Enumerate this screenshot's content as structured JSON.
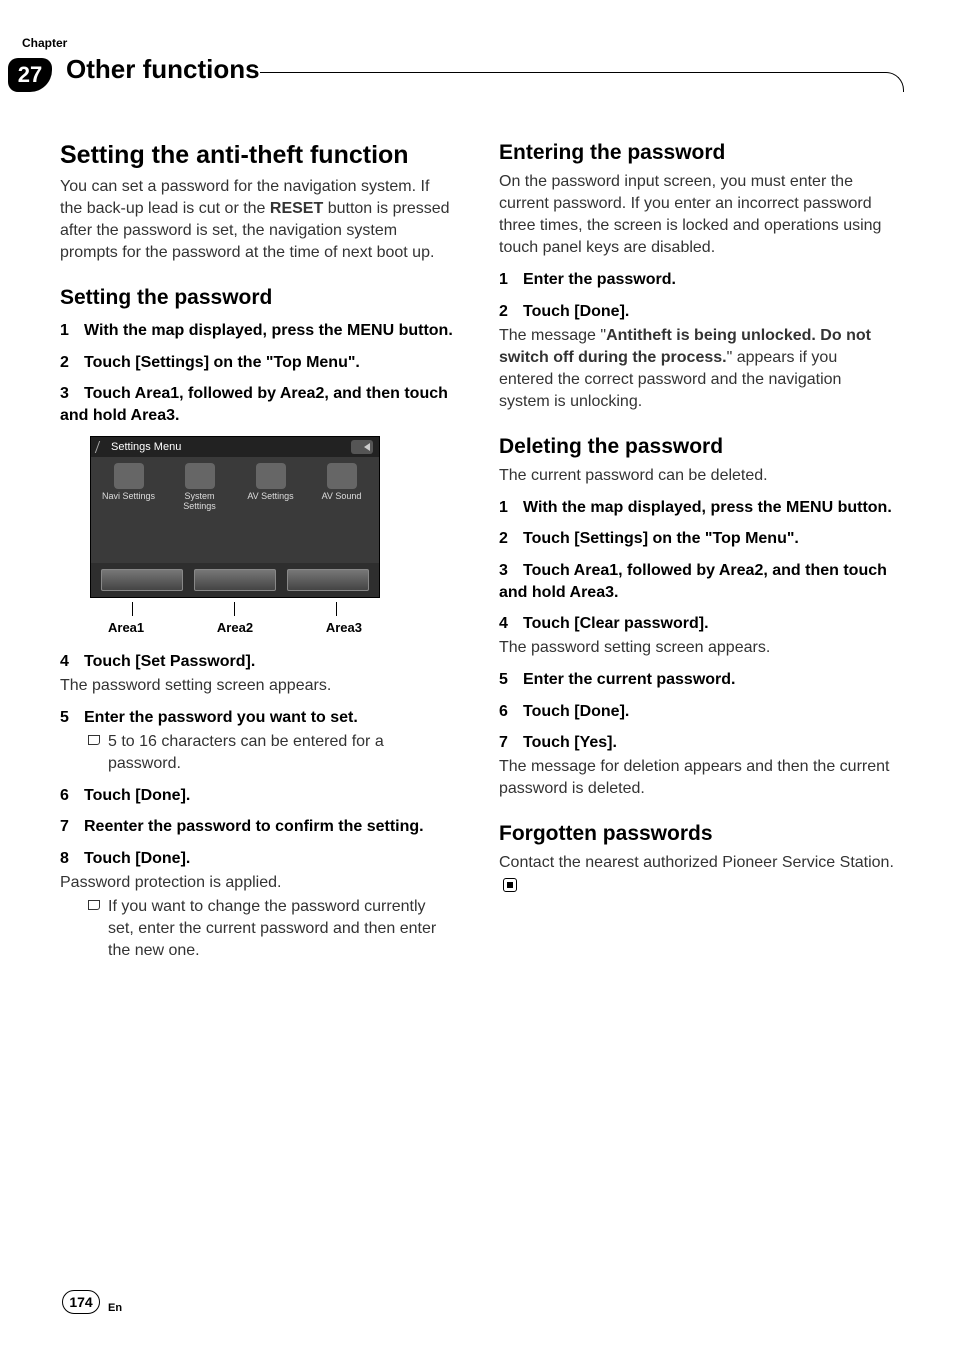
{
  "header": {
    "chapter_label": "Chapter",
    "chapter_number": "27",
    "title": "Other functions"
  },
  "left": {
    "h1": "Setting the anti-theft function",
    "intro_a": "You can set a password for the navigation system. If the back-up lead is cut or the ",
    "intro_bold": "RESET",
    "intro_b": " button is pressed after the password is set, the navigation system prompts for the password at the time of next boot up.",
    "h2": "Setting the password",
    "s1": "With the map displayed, press the MENU button.",
    "s2": "Touch [Settings] on the \"Top Menu\".",
    "s3": "Touch Area1, followed by Area2, and then touch and hold Area3.",
    "shot": {
      "title": "Settings Menu",
      "items": [
        "Navi Settings",
        "System Settings",
        "AV Settings",
        "AV Sound"
      ],
      "areas": [
        "Area1",
        "Area2",
        "Area3"
      ]
    },
    "s4": "Touch [Set Password].",
    "s4_after": "The password setting screen appears.",
    "s5": "Enter the password you want to set.",
    "s5_note": "5 to 16 characters can be entered for a password.",
    "s6": "Touch [Done].",
    "s7": "Reenter the password to confirm the setting.",
    "s8": "Touch [Done].",
    "s8_after": "Password protection is applied.",
    "s8_note": "If you want to change the password currently set, enter the current password and then enter the new one."
  },
  "right": {
    "h2a": "Entering the password",
    "pa": "On the password input screen, you must enter the current password. If you enter an incorrect password three times, the screen is locked and operations using touch panel keys are disabled.",
    "s1": "Enter the password.",
    "s2": "Touch [Done].",
    "s2_after_a": "The message \"",
    "s2_after_bold": "Antitheft is being unlocked. Do not switch off during the process.",
    "s2_after_b": "\" appears if you entered the correct password and the navigation system is unlocking.",
    "h2b": "Deleting the password",
    "pb": "The current password can be deleted.",
    "d1": "With the map displayed, press the MENU button.",
    "d2": "Touch [Settings] on the \"Top Menu\".",
    "d3": "Touch Area1, followed by Area2, and then touch and hold Area3.",
    "d4": "Touch [Clear password].",
    "d4_after": "The password setting screen appears.",
    "d5": "Enter the current password.",
    "d6": "Touch [Done].",
    "d7": "Touch [Yes].",
    "d7_after": "The message for deletion appears and then the current password is deleted.",
    "h2c": "Forgotten passwords",
    "pc": "Contact the nearest authorized Pioneer Service Station."
  },
  "footer": {
    "page": "174",
    "lang": "En"
  }
}
